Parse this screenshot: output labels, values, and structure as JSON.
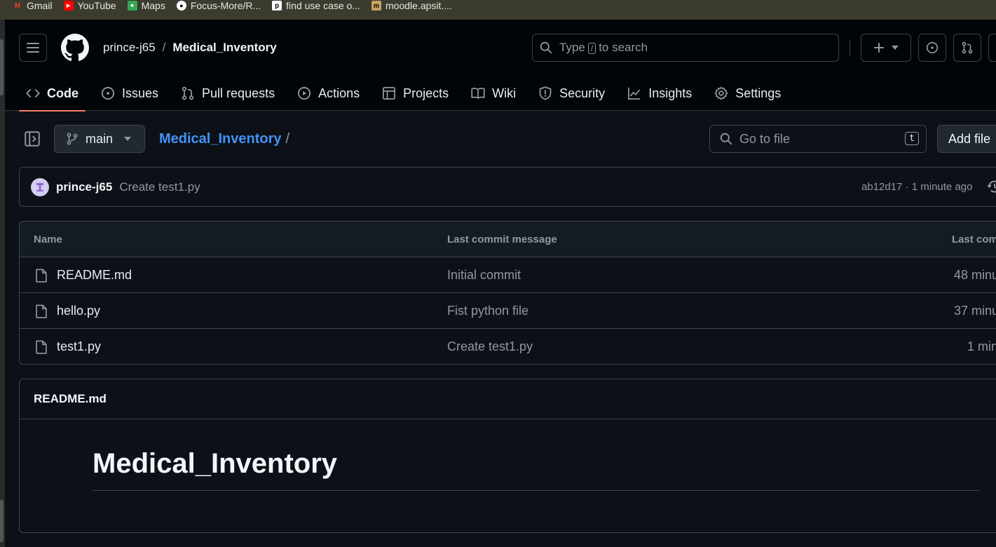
{
  "bookmarks": [
    {
      "label": "Gmail",
      "icon": "gmail-icon",
      "color": "#ea4335"
    },
    {
      "label": "YouTube",
      "icon": "youtube-icon",
      "color": "#ff0000"
    },
    {
      "label": "Maps",
      "icon": "maps-icon",
      "color": "#34a853"
    },
    {
      "label": "Focus-More/R...",
      "icon": "github-icon",
      "color": "#ffffff"
    },
    {
      "label": "find use case o...",
      "icon": "p-icon",
      "color": "#000000"
    },
    {
      "label": "moodle.apsit....",
      "icon": "moodle-icon",
      "color": "#c8a060"
    }
  ],
  "header": {
    "owner": "prince-j65",
    "separator": "/",
    "repo": "Medical_Inventory",
    "search_prefix": "Type",
    "search_key": "/",
    "search_suffix": "to search"
  },
  "tabs": [
    {
      "label": "Code",
      "icon": "code-icon",
      "active": true
    },
    {
      "label": "Issues",
      "icon": "issue-icon"
    },
    {
      "label": "Pull requests",
      "icon": "pull-request-icon"
    },
    {
      "label": "Actions",
      "icon": "play-icon"
    },
    {
      "label": "Projects",
      "icon": "table-icon"
    },
    {
      "label": "Wiki",
      "icon": "book-icon"
    },
    {
      "label": "Security",
      "icon": "shield-icon"
    },
    {
      "label": "Insights",
      "icon": "graph-icon"
    },
    {
      "label": "Settings",
      "icon": "gear-icon"
    }
  ],
  "repo_bar": {
    "branch": "main",
    "path_link": "Medical_Inventory",
    "path_sep": "/",
    "goto_placeholder": "Go to file",
    "goto_key": "t",
    "add_file": "Add file"
  },
  "commit": {
    "author": "prince-j65",
    "message": "Create test1.py",
    "meta": "ab12d17 · 1 minute ago"
  },
  "files": {
    "headers": {
      "name": "Name",
      "message": "Last commit message",
      "date": "Last com"
    },
    "rows": [
      {
        "name": "README.md",
        "message": "Initial commit",
        "date": "48 minu"
      },
      {
        "name": "hello.py",
        "message": "Fist python file",
        "date": "37 minu"
      },
      {
        "name": "test1.py",
        "message": "Create test1.py",
        "date": "1 min"
      }
    ]
  },
  "readme": {
    "filename": "README.md",
    "heading": "Medical_Inventory"
  },
  "colors": {
    "accent": "#f78166",
    "link": "#4493f8",
    "bg": "#0d1117",
    "header_bg": "#010409"
  }
}
